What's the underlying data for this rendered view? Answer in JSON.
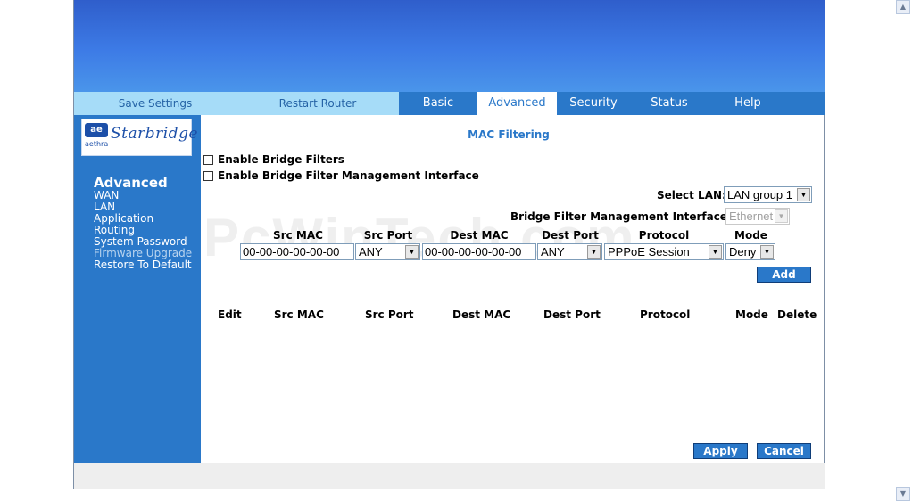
{
  "header": {
    "save_settings": "Save Settings",
    "restart_router": "Restart Router"
  },
  "tabs": [
    {
      "label": "Basic"
    },
    {
      "label": "Advanced",
      "active": true
    },
    {
      "label": "Security"
    },
    {
      "label": "Status"
    },
    {
      "label": "Help"
    }
  ],
  "logo": {
    "mark": "ae",
    "brand_small": "aethra",
    "brand_script": "Starbridge"
  },
  "sidebar": {
    "title": "Advanced",
    "items": [
      {
        "label": "WAN"
      },
      {
        "label": "LAN"
      },
      {
        "label": "Application"
      },
      {
        "label": "Routing"
      },
      {
        "label": "System Password"
      },
      {
        "label": "Firmware Upgrade",
        "dimmed": true
      },
      {
        "label": "Restore To Default"
      }
    ]
  },
  "main": {
    "title": "MAC Filtering",
    "enable_bridge_filters": "Enable Bridge Filters",
    "enable_bridge_mgmt": "Enable Bridge Filter Management Interface",
    "select_lan_label": "Select LAN:",
    "select_lan_value": "LAN group 1",
    "bridge_mgmt_label": "Bridge Filter Management Interface:",
    "bridge_mgmt_value": "Ethernet",
    "form_headers": {
      "src_mac": "Src MAC",
      "src_port": "Src Port",
      "dest_mac": "Dest MAC",
      "dest_port": "Dest Port",
      "protocol": "Protocol",
      "mode": "Mode"
    },
    "form_values": {
      "src_mac": "00-00-00-00-00-00",
      "src_port": "ANY",
      "dest_mac": "00-00-00-00-00-00",
      "dest_port": "ANY",
      "protocol": "PPPoE Session",
      "mode": "Deny"
    },
    "add_button": "Add",
    "table_headers": [
      "Edit",
      "Src MAC",
      "Src Port",
      "Dest MAC",
      "Dest Port",
      "Protocol",
      "Mode",
      "Delete"
    ],
    "apply_button": "Apply",
    "cancel_button": "Cancel"
  },
  "watermark": "PcWinTech.com",
  "colors": {
    "accent": "#2a78c9",
    "light_tab": "#a6dcf8",
    "banner": "#3d7be6"
  }
}
